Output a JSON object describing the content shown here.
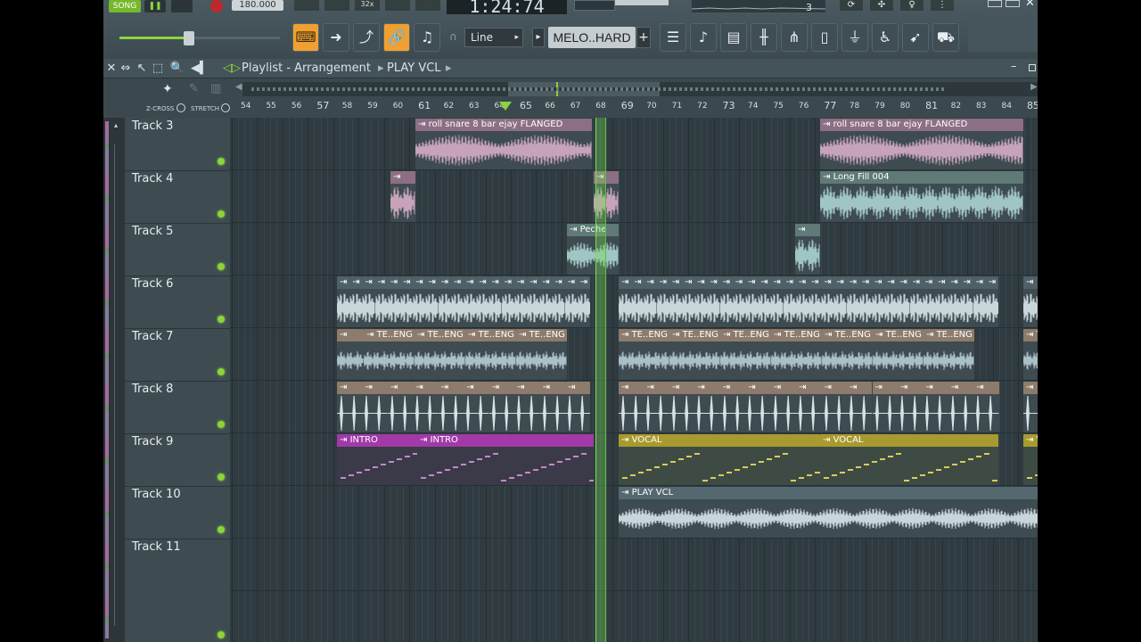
{
  "toolbar": {
    "song_label": "SONG",
    "tempo": "180.000",
    "time": "1:24:74",
    "counter": "3",
    "snap": "Line",
    "preset": "MELO..HARD",
    "accent": "#f0a030"
  },
  "playlist": {
    "title": "Playlist - Arrangement",
    "pattern": "PLAY VCL",
    "zcross_label": "Z-CROSS",
    "stretch_label": "STRETCH"
  },
  "ruler": [
    "54",
    "55",
    "56",
    "57",
    "58",
    "59",
    "60",
    "61",
    "62",
    "63",
    "64",
    "65",
    "66",
    "67",
    "68",
    "69",
    "70",
    "71",
    "72",
    "73",
    "74",
    "75",
    "76",
    "77",
    "78",
    "79",
    "80",
    "81",
    "82",
    "83",
    "84",
    "85"
  ],
  "tracks": [
    {
      "name": "Track 3"
    },
    {
      "name": "Track 4"
    },
    {
      "name": "Track 5"
    },
    {
      "name": "Track 6"
    },
    {
      "name": "Track 7"
    },
    {
      "name": "Track 8"
    },
    {
      "name": "Track 9"
    },
    {
      "name": "Track 10"
    },
    {
      "name": "Track 11"
    }
  ],
  "clips": {
    "roll_snare": "roll snare 8 bar ejay FLANGED",
    "long_fill": "Long Fill 004",
    "peche": "Peche",
    "te_eng": "TE..ENG",
    "intro": "INTRO",
    "vocal": "VOCAL",
    "play_vcl": "PLAY VCL"
  },
  "colors": {
    "pink": "#c6a3b8",
    "teal": "#9fc6c2",
    "steel": "#a9c0c8",
    "brown": "#8d7b6b",
    "purple": "#a13aa8",
    "olive": "#a89a2e",
    "playhead": "#7be04f"
  }
}
